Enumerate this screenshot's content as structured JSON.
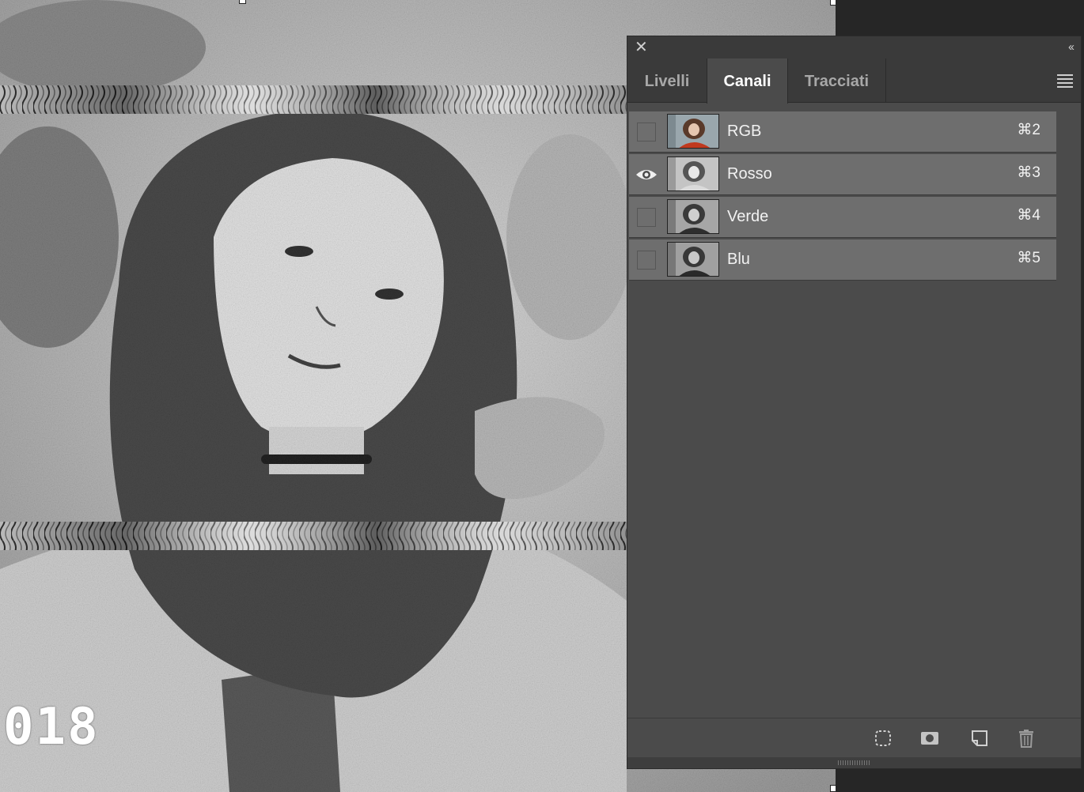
{
  "canvas": {
    "overlay_text": "018"
  },
  "panel": {
    "tabs": [
      {
        "label": "Livelli",
        "active": false
      },
      {
        "label": "Canali",
        "active": true
      },
      {
        "label": "Tracciati",
        "active": false
      }
    ],
    "channels": [
      {
        "name": "RGB",
        "shortcut": "⌘2",
        "visible": false,
        "thumb": "color"
      },
      {
        "name": "Rosso",
        "shortcut": "⌘3",
        "visible": true,
        "thumb": "gray"
      },
      {
        "name": "Verde",
        "shortcut": "⌘4",
        "visible": false,
        "thumb": "dark"
      },
      {
        "name": "Blu",
        "shortcut": "⌘5",
        "visible": false,
        "thumb": "dark"
      }
    ],
    "footer_icons": [
      "load-selection-icon",
      "save-selection-icon",
      "new-channel-icon",
      "delete-channel-icon"
    ]
  },
  "colors": {
    "panel_bg": "#4b4b4b",
    "row_bg": "#6e6e6e",
    "titlebar_bg": "#3a3a3a",
    "accent_red": "#c0391e"
  }
}
